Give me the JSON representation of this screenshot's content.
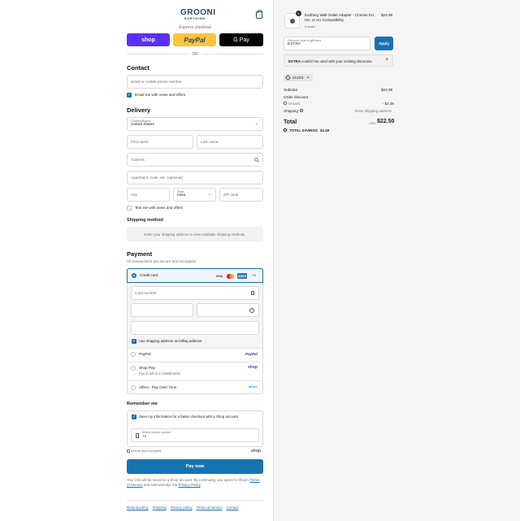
{
  "header": {
    "logo_text": "GROONI",
    "logo_subtitle": "EARTHING"
  },
  "express": {
    "label": "Express checkout",
    "shop_label": "shop",
    "paypal_label": "PayPal",
    "gpay_label": "G Pay",
    "or_label": "OR"
  },
  "contact": {
    "title": "Contact",
    "email_placeholder": "Email or mobile phone number",
    "news_label": "Email me with news and offers"
  },
  "delivery": {
    "title": "Delivery",
    "country_label": "Country/Region",
    "country_value": "United States",
    "first_name_placeholder": "First name",
    "last_name_placeholder": "Last name",
    "address_placeholder": "Address",
    "apartment_placeholder": "Apartment, suite, etc. (optional)",
    "city_placeholder": "City",
    "state_label": "State",
    "state_value": "Iowa",
    "zip_placeholder": "ZIP code",
    "text_label": "Text me with news and offers"
  },
  "shipping_method": {
    "title": "Shipping method",
    "info": "Enter your shipping address to view available shipping methods."
  },
  "payment": {
    "title": "Payment",
    "subtitle": "All transactions are secure and encrypted.",
    "credit_card_label": "Credit card",
    "card_brands": [
      "VISA",
      "MC",
      "AMEX"
    ],
    "more_brands": "+1",
    "card_number_placeholder": "Card number",
    "billing_label": "Use shipping address as billing address",
    "paypal_label": "PayPal",
    "paypal_logo": "PayPal",
    "shoppay_label": "Shop Pay",
    "shoppay_sub": "Pay in full or in installments",
    "shoppay_logo": "shop",
    "affirm_label": "Affirm - Pay Over Time",
    "affirm_logo": "affirm"
  },
  "remember": {
    "title": "Remember me",
    "save_label": "Save my information for a faster checkout with a Shop account",
    "phone_label": "Mobile phone number",
    "phone_value": "+1",
    "secure_label": "Secure and encrypted",
    "shop_logo": "shop"
  },
  "pay_now_label": "Pay now",
  "legal": {
    "text_1": "Your info will be saved to a Shop account. By continuing, you agree to Shop's",
    "terms_link": "Terms of Service",
    "text_2": "and acknowledge the",
    "privacy_link": "Privacy Policy",
    "text_3": "."
  },
  "footer_links": [
    "Refund policy",
    "Shipping",
    "Privacy policy",
    "Terms of service",
    "Contact"
  ],
  "summary": {
    "item_qty": "1",
    "item_title": "Earthing Wall Outlet Adapter - Choose EU, UK, or AU Compatibility",
    "item_variant": "Europe",
    "item_price": "$24.99",
    "discount_label": "Discount code or gift card",
    "discount_value": "EXTRA",
    "apply_label": "Apply",
    "error_code": "EXTRA",
    "error_text": "couldn't be used with your existing discounts.",
    "tag_label": "SALES",
    "subtotal_label": "Subtotal",
    "subtotal_value": "$24.99",
    "order_discount_label": "Order discount",
    "discount_code": "SALES",
    "discount_amount": "- $2.49",
    "shipping_label": "Shipping",
    "shipping_value": "Enter shipping address",
    "total_label": "Total",
    "currency": "USD",
    "total_value": "$22.50",
    "savings_label": "TOTAL SAVINGS",
    "savings_value": "$2.49"
  },
  "colors": {
    "accent": "#1773b0",
    "shop_purple": "#5a31f4",
    "paypal_yellow": "#ffc439",
    "brand": "#1c4f63"
  }
}
